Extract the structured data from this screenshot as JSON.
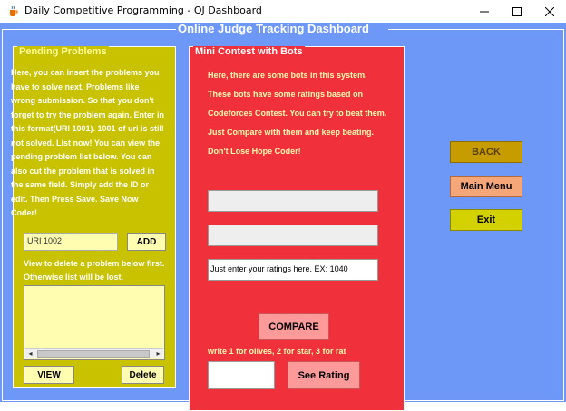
{
  "window": {
    "title": "Daily Competitive Programming - OJ Dashboard",
    "icon": "java-cup-icon",
    "controls": [
      "minimize-icon",
      "maximize-icon",
      "close-icon"
    ]
  },
  "header": {
    "title": "Online Judge Tracking Dashboard"
  },
  "pending": {
    "title": "Pending Problems",
    "description": "Here, you can insert the problems you have to solve next. Problems like wrong submission. So that you don't forget to try the problem again. Enter in this format(URI 1001). 1001 of uri is still not solved. List now! You can view the pending problem list below. You can also cut the problem that is solved in the same field. Simply add the ID or edit. Then Press Save. Save Now Coder!",
    "input_value": "URI 1002",
    "add_label": "ADD",
    "delete_hint": "View to delete a problem below first. Otherwise list will be lost.",
    "view_label": "VIEW",
    "delete_label": "Delete"
  },
  "mini": {
    "title": "Mini Contest with Bots",
    "lines": [
      "Here, there are some bots in this system.",
      "These bots have some ratings based on",
      "Codeforces Contest. You can try to beat them.",
      "Just Compare with them and keep beating.",
      "Don't Lose Hope Coder!"
    ],
    "rating_input_value": "Just enter your ratings here. EX: 1040",
    "compare_label": "COMPARE",
    "hint": "write 1 for olives, 2 for star, 3 for rat",
    "see_rating_label": "See Rating"
  },
  "nav": {
    "back_label": "BACK",
    "menu_label": "Main Menu",
    "exit_label": "Exit"
  },
  "colors": {
    "background": "#6d98f7",
    "pending_panel": "#c8c200",
    "mini_panel": "#f0303a",
    "back_button": "#c79c00",
    "menu_button": "#f6a77a",
    "exit_button": "#d4d100"
  }
}
